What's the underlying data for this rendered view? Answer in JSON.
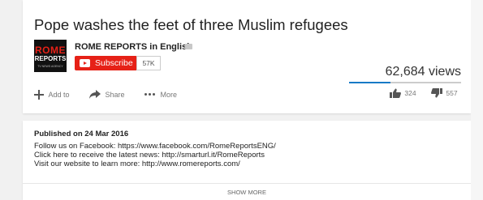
{
  "video": {
    "title": "Pope washes the feet of three Muslim refugees",
    "views": "62,684 views",
    "like_fraction": 0.37
  },
  "channel": {
    "name": "ROME REPORTS in English",
    "logo_line1": "ROME",
    "logo_line2": "REPORTS",
    "logo_line3": "TV NEWS AGENCY",
    "subscribe_label": "Subscribe",
    "subscriber_count": "57K"
  },
  "actions": {
    "add_to": "Add to",
    "share": "Share",
    "more": "More",
    "likes": "324",
    "dislikes": "557"
  },
  "description": {
    "published": "Published on 24 Mar 2016",
    "lines": [
      "Follow us on Facebook: https://www.facebook.com/RomeReportsENG/",
      "Click here to receive the latest news: http://smarturl.it/RomeReports",
      "Visit our website to learn more: http://www.romereports.com/"
    ],
    "show_more": "SHOW MORE"
  },
  "colors": {
    "subscribe": "#e62117",
    "like_bar": "#167ac6",
    "dislike_bar": "#cccccc"
  }
}
